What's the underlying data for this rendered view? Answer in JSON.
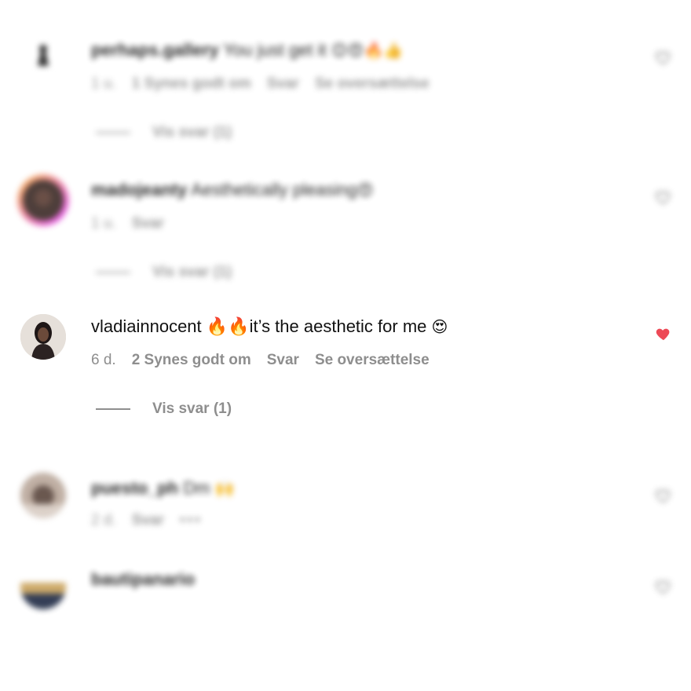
{
  "comments": [
    {
      "username": "perhaps.gallery",
      "text": "You just get it",
      "emoji": "😊😍🔥👍",
      "time": "1 u.",
      "likes": "1 Synes godt om",
      "reply": "Svar",
      "translate": "Se oversættelse",
      "view_replies": "Vis svar (1)"
    },
    {
      "username": "madojeanty",
      "text": "Aesthetically pleasing",
      "emoji": "😍",
      "time": "1 u.",
      "reply": "Svar",
      "view_replies": "Vis svar (1)"
    },
    {
      "username": "vladiainnocent",
      "text": "🔥🔥it’s the aesthetic for me",
      "emoji": "😍",
      "time": "6 d.",
      "likes": "2 Synes godt om",
      "reply": "Svar",
      "translate": "Se oversættelse",
      "view_replies": "Vis svar (1)",
      "liked": true
    },
    {
      "username": "puesto_ph",
      "text": "Dm",
      "emoji": "🙌",
      "time": "2 d.",
      "reply": "Svar",
      "more": "•••"
    },
    {
      "username": "bautipanario",
      "text": ""
    }
  ],
  "colors": {
    "liked_heart": "#ed4956",
    "muted_text": "#8e8e8e"
  },
  "icons": {
    "heart_outline": "heart-outline-icon",
    "heart_filled": "heart-filled-icon"
  }
}
